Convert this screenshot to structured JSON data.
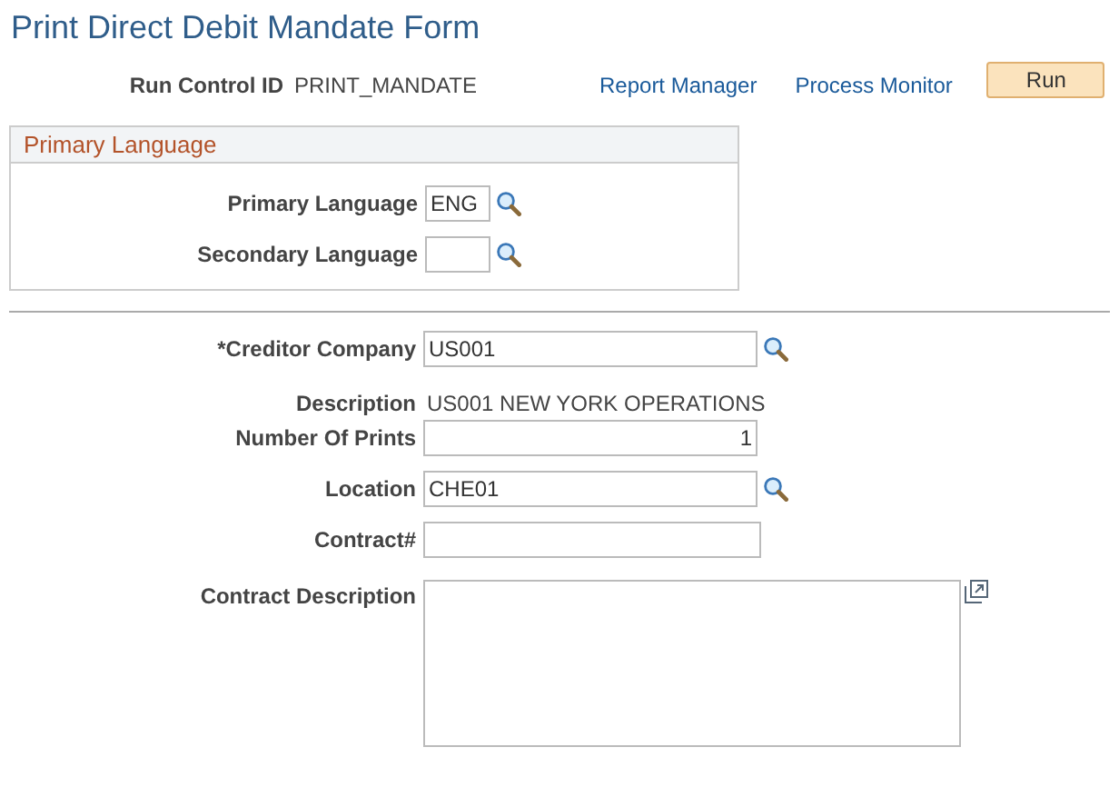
{
  "title": "Print Direct Debit Mandate Form",
  "run_control": {
    "label": "Run Control ID",
    "value": "PRINT_MANDATE"
  },
  "links": [
    "Report Manager",
    "Process Monitor"
  ],
  "run_button": "Run",
  "group": {
    "title": "Primary Language",
    "fields": [
      {
        "kind": "code_lookup",
        "label": "Primary Language",
        "value": "ENG"
      },
      {
        "kind": "code_lookup",
        "label": "Secondary Language"
      }
    ]
  },
  "fields": [
    {
      "kind": "lookup",
      "label": "*Creditor Company",
      "value": "US001"
    },
    {
      "kind": "display",
      "label": "Description",
      "value": "US001 NEW YORK OPERATIONS"
    },
    {
      "kind": "number",
      "label": "Number Of Prints",
      "value": "1"
    },
    {
      "kind": "lookup",
      "label": "Location",
      "value": "CHE01"
    },
    {
      "kind": "text",
      "label": "Contract#"
    },
    {
      "kind": "textarea",
      "label": "Contract Description"
    }
  ]
}
